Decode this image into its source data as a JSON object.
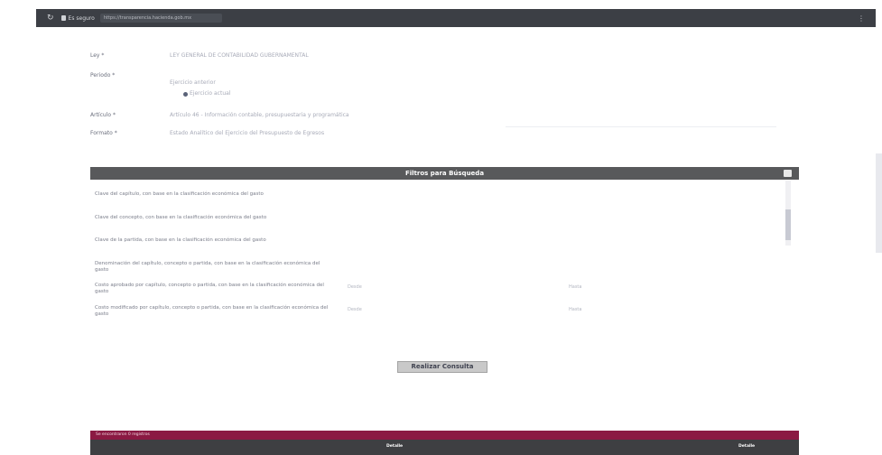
{
  "browser": {
    "secure_label": "Es seguro",
    "url": "https://transparencia.hacienda.gob.mx",
    "menu_icon": "kebab-menu-icon",
    "reload_icon": "reload-icon",
    "lock_icon": "lock-icon"
  },
  "form": {
    "ley_label": "Ley *",
    "ley_value": "LEY GENERAL DE CONTABILIDAD GUBERNAMENTAL",
    "periodo_label": "Periodo *",
    "periodo_option_1": "Ejercicio anterior",
    "periodo_option_2": "Ejercicio actual",
    "articulo_label": "Artículo *",
    "articulo_value": "Artículo 46 - Información contable, presupuestaria y programática",
    "formato_label": "Formato *",
    "formato_value": "Estado Analítico del Ejercicio del Presupuesto de Egresos"
  },
  "filters": {
    "title": "Filtros para Búsqueda",
    "items": [
      "Clave del capítulo, con base en la clasificación económica del gasto",
      "Clave del concepto, con base en la clasificación económica del gasto",
      "Clave de la partida, con base en la clasificación económica del gasto",
      "Denominación del capítulo, concepto o partida, con base en la clasificación económica del gasto",
      "Costo aprobado por capítulo, concepto o partida, con base en la clasificación económica del gasto",
      "Costo modificado por capítulo, concepto o partida, con base en la clasificación económica del gasto"
    ],
    "range_from": "Desde",
    "range_to": "Hasta"
  },
  "actions": {
    "query_button": "Realizar Consulta"
  },
  "results": {
    "title": "Se encontraron 0 registros",
    "col_a": "Detalle",
    "col_b": "Detalle"
  },
  "colors": {
    "header_dark": "#58595b",
    "results_accent": "#8b1a43"
  }
}
